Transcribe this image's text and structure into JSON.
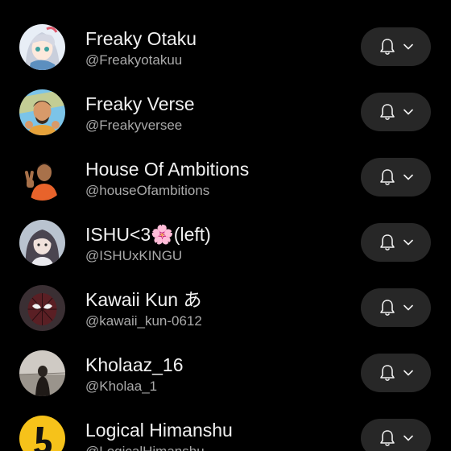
{
  "channels": [
    {
      "name": "Freaky Otaku",
      "handle": "@Freakyotakuu",
      "avatar_icon": "anime-girl-avatar"
    },
    {
      "name": "Freaky Verse",
      "handle": "@Freakyversee",
      "avatar_icon": "cartoon-man-avatar"
    },
    {
      "name": "House Of Ambitions",
      "handle": "@houseOfambitions",
      "avatar_icon": "man-peace-sign-avatar"
    },
    {
      "name": "ISHU<3🌸(left)",
      "handle": "@ISHUxKINGU",
      "avatar_icon": "girl-photo-avatar"
    },
    {
      "name": "Kawaii Kun あ",
      "handle": "@kawaii_kun-0612",
      "avatar_icon": "spider-mask-avatar"
    },
    {
      "name": "Kholaaz_16",
      "handle": "@Kholaa_1",
      "avatar_icon": "girl-by-sea-avatar"
    },
    {
      "name": "Logical Himanshu",
      "handle": "@LogicalHimanshu",
      "avatar_icon": "yellow-logo-avatar"
    }
  ],
  "notification_button": {
    "icon": "bell-icon",
    "dropdown_icon": "chevron-down-icon"
  },
  "colors": {
    "background": "#000000",
    "button_bg": "#272727",
    "name_text": "#f1f1f1",
    "handle_text": "#aaaaaa",
    "logo_yellow": "#f6c21a"
  }
}
